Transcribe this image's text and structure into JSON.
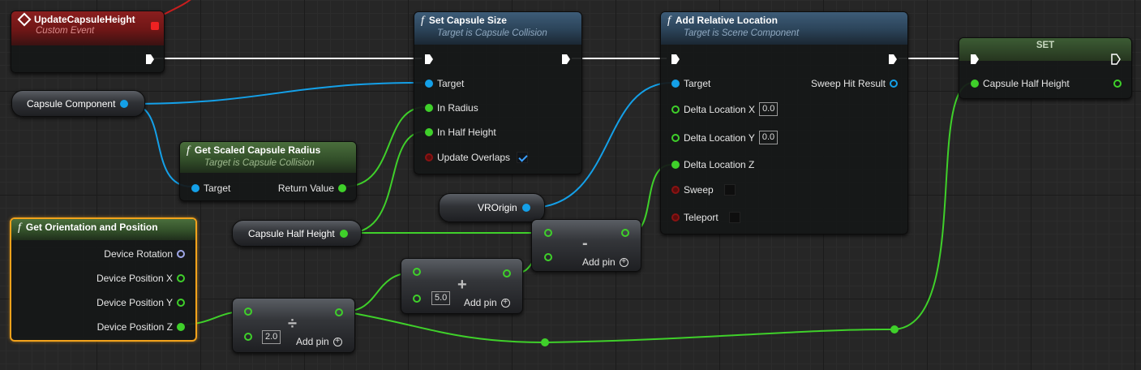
{
  "event_node": {
    "title": "UpdateCapsuleHeight",
    "subtitle": "Custom Event"
  },
  "set_capsule_size": {
    "title": "Set Capsule Size",
    "subtitle": "Target is Capsule Collision",
    "pins": {
      "target": "Target",
      "in_radius": "In Radius",
      "in_half_height": "In Half Height",
      "update_overlaps": "Update Overlaps"
    },
    "update_overlaps_checked": true
  },
  "add_relative_location": {
    "title": "Add Relative Location",
    "subtitle": "Target is Scene Component",
    "pins": {
      "target": "Target",
      "sweep_hit_result": "Sweep Hit Result",
      "delta_x": "Delta Location X",
      "delta_x_value": "0.0",
      "delta_y": "Delta Location Y",
      "delta_y_value": "0.0",
      "delta_z": "Delta Location Z",
      "sweep": "Sweep",
      "teleport": "Teleport"
    }
  },
  "set_node": {
    "title": "SET",
    "pin": "Capsule Half Height"
  },
  "capsule_component_var": {
    "label": "Capsule Component"
  },
  "get_scaled_radius": {
    "title": "Get Scaled Capsule Radius",
    "subtitle": "Target is Capsule Collision",
    "pins": {
      "target": "Target",
      "return_value": "Return Value"
    }
  },
  "vrorigin_var": {
    "label": "VROrigin"
  },
  "capsule_half_height_var": {
    "label": "Capsule Half Height"
  },
  "get_orientation": {
    "title": "Get Orientation and Position",
    "pins": {
      "rotation": "Device Rotation",
      "pos_x": "Device Position X",
      "pos_y": "Device Position Y",
      "pos_z": "Device Position Z"
    }
  },
  "subtract_node": {
    "symbol": "-",
    "add_pin": "Add pin"
  },
  "add_node": {
    "symbol": "+",
    "value": "5.0",
    "add_pin": "Add pin"
  },
  "divide_node": {
    "symbol": "÷",
    "value": "2.0",
    "add_pin": "Add pin"
  },
  "icons": {
    "function": "f",
    "event": "event-diamond-icon",
    "exec": "exec-pin-icon"
  },
  "colors": {
    "float_pin": "#3fd02a",
    "object_pin": "#14a0e8",
    "bool_pin": "#8a1212",
    "selected": "#f2a21b"
  }
}
